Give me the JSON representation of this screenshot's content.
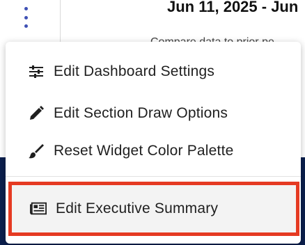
{
  "header": {
    "date_range": "Jun 11, 2025 - Jun",
    "subtext": "Compare data to prior pe"
  },
  "menu": {
    "items": [
      {
        "label": "Edit Dashboard Settings",
        "icon": "sliders-icon"
      },
      {
        "label": "Edit Section Draw Options",
        "icon": "pencil-icon"
      },
      {
        "label": "Reset Widget Color Palette",
        "icon": "paintbrush-icon"
      },
      {
        "label": "Edit Executive Summary",
        "icon": "newspaper-icon"
      }
    ]
  },
  "colors": {
    "accent": "#3f51b5",
    "highlight_border": "#e53a22",
    "navy": "#0b1f4d"
  }
}
